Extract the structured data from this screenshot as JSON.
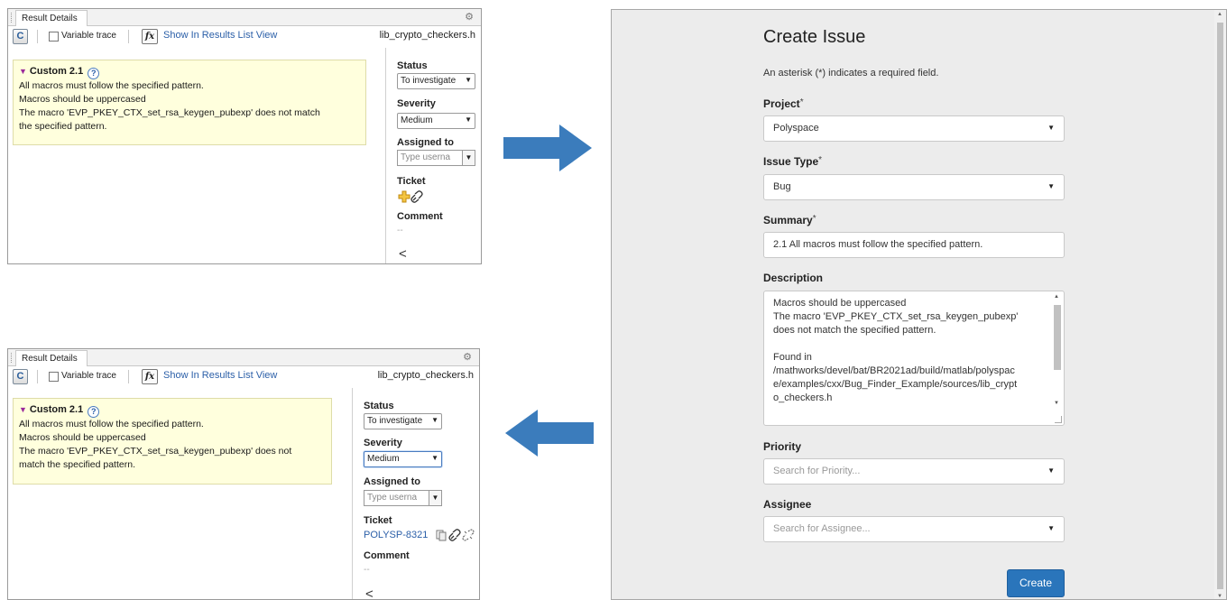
{
  "panel_top": {
    "tab_title": "Result Details",
    "variable_trace": "Variable trace",
    "show_in_list": "Show In Results List View",
    "file": "lib_crypto_checkers.h",
    "result_title": "Custom 2.1",
    "messages": [
      "All macros must follow the specified pattern.",
      "Macros should be uppercased",
      "The macro 'EVP_PKEY_CTX_set_rsa_keygen_pubexp' does not match",
      "the specified pattern."
    ],
    "status_label": "Status",
    "status_value": "To investigate",
    "severity_label": "Severity",
    "severity_value": "Medium",
    "assigned_label": "Assigned to",
    "assigned_placeholder": "Type userna",
    "ticket_label": "Ticket",
    "comment_label": "Comment",
    "comment_value": "--",
    "collapse_glyph": "<"
  },
  "panel_bottom": {
    "tab_title": "Result Details",
    "variable_trace": "Variable trace",
    "show_in_list": "Show In Results List View",
    "file": "lib_crypto_checkers.h",
    "result_title": "Custom 2.1",
    "messages": [
      "All macros must follow the specified pattern.",
      "Macros should be uppercased",
      "The macro 'EVP_PKEY_CTX_set_rsa_keygen_pubexp' does not",
      "match the specified pattern."
    ],
    "status_label": "Status",
    "status_value": "To investigate",
    "severity_label": "Severity",
    "severity_value": "Medium",
    "assigned_label": "Assigned to",
    "assigned_placeholder": "Type userna",
    "ticket_label": "Ticket",
    "ticket_value": "POLYSP-8321",
    "comment_label": "Comment",
    "comment_value": "--",
    "collapse_glyph": "<"
  },
  "create_issue": {
    "title": "Create Issue",
    "required_note": "An asterisk (*) indicates a required field.",
    "project_label": "Project",
    "project_value": "Polyspace",
    "issue_type_label": "Issue Type",
    "issue_type_value": "Bug",
    "summary_label": "Summary",
    "summary_value": "2.1 All macros must follow the specified pattern.",
    "description_label": "Description",
    "description_lines": [
      "Macros should be uppercased",
      "The macro 'EVP_PKEY_CTX_set_rsa_keygen_pubexp'",
      "does not match the specified pattern.",
      "",
      "Found in",
      "/mathworks/devel/bat/BR2021ad/build/matlab/polyspac",
      "e/examples/cxx/Bug_Finder_Example/sources/lib_crypt",
      "o_checkers.h"
    ],
    "priority_label": "Priority",
    "priority_placeholder": "Search for Priority...",
    "assignee_label": "Assignee",
    "assignee_placeholder": "Search for Assignee...",
    "create_button": "Create"
  },
  "colors": {
    "arrow": "#3b7cbc",
    "message_bg": "#ffffdd",
    "create_button": "#2a75bb",
    "link": "#2b5fa8"
  },
  "icons": [
    "gear-icon",
    "refresh-icon",
    "fx-icon",
    "help-icon",
    "triangle-down-icon",
    "add-ticket-icon",
    "link-icon",
    "copy-icon",
    "unlink-icon",
    "dropdown-arrow-icon",
    "collapse-chevron-icon",
    "right-arrow-icon",
    "left-arrow-icon"
  ]
}
